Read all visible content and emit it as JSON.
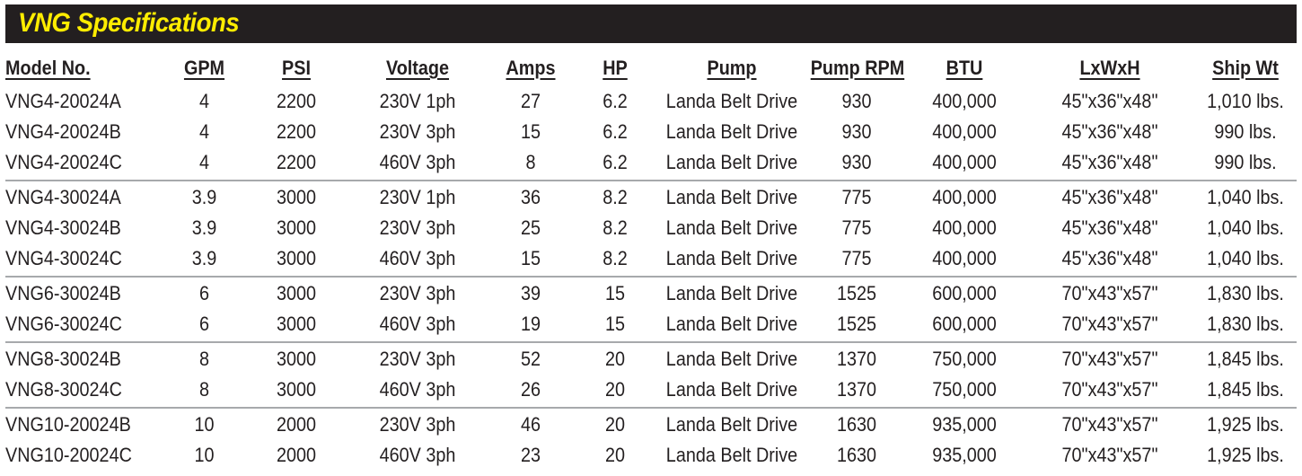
{
  "title": "VNG Specifications",
  "colors": {
    "title_bar": "#231f20",
    "title_text": "#ffed00",
    "separator": "#a7a9ac"
  },
  "columns": [
    "Model No.",
    "GPM",
    "PSI",
    "Voltage",
    "Amps",
    "HP",
    "Pump",
    "Pump RPM",
    "BTU",
    "LxWxH",
    "Ship Wt"
  ],
  "groups": [
    [
      [
        "VNG4-20024A",
        "4",
        "2200",
        "230V 1ph",
        "27",
        "6.2",
        "Landa Belt Drive",
        "930",
        "400,000",
        "45\"x36\"x48\"",
        "1,010 lbs."
      ],
      [
        "VNG4-20024B",
        "4",
        "2200",
        "230V 3ph",
        "15",
        "6.2",
        "Landa Belt Drive",
        "930",
        "400,000",
        "45\"x36\"x48\"",
        "990 lbs."
      ],
      [
        "VNG4-20024C",
        "4",
        "2200",
        "460V 3ph",
        "8",
        "6.2",
        "Landa Belt Drive",
        "930",
        "400,000",
        "45\"x36\"x48\"",
        "990 lbs."
      ]
    ],
    [
      [
        "VNG4-30024A",
        "3.9",
        "3000",
        "230V 1ph",
        "36",
        "8.2",
        "Landa Belt Drive",
        "775",
        "400,000",
        "45\"x36\"x48\"",
        "1,040 lbs."
      ],
      [
        "VNG4-30024B",
        "3.9",
        "3000",
        "230V 3ph",
        "25",
        "8.2",
        "Landa Belt Drive",
        "775",
        "400,000",
        "45\"x36\"x48\"",
        "1,040 lbs."
      ],
      [
        "VNG4-30024C",
        "3.9",
        "3000",
        "460V 3ph",
        "15",
        "8.2",
        "Landa Belt Drive",
        "775",
        "400,000",
        "45\"x36\"x48\"",
        "1,040 lbs."
      ]
    ],
    [
      [
        "VNG6-30024B",
        "6",
        "3000",
        "230V 3ph",
        "39",
        "15",
        "Landa Belt Drive",
        "1525",
        "600,000",
        "70\"x43\"x57\"",
        "1,830 lbs."
      ],
      [
        "VNG6-30024C",
        "6",
        "3000",
        "460V 3ph",
        "19",
        "15",
        "Landa Belt Drive",
        "1525",
        "600,000",
        "70\"x43\"x57\"",
        "1,830 lbs."
      ]
    ],
    [
      [
        "VNG8-30024B",
        "8",
        "3000",
        "230V 3ph",
        "52",
        "20",
        "Landa Belt Drive",
        "1370",
        "750,000",
        "70\"x43\"x57\"",
        "1,845 lbs."
      ],
      [
        "VNG8-30024C",
        "8",
        "3000",
        "460V 3ph",
        "26",
        "20",
        "Landa Belt Drive",
        "1370",
        "750,000",
        "70\"x43\"x57\"",
        "1,845 lbs."
      ]
    ],
    [
      [
        "VNG10-20024B",
        "10",
        "2000",
        "230V 3ph",
        "46",
        "20",
        "Landa Belt Drive",
        "1630",
        "935,000",
        "70\"x43\"x57\"",
        "1,925 lbs."
      ],
      [
        "VNG10-20024C",
        "10",
        "2000",
        "460V 3ph",
        "23",
        "20",
        "Landa Belt Drive",
        "1630",
        "935,000",
        "70\"x43\"x57\"",
        "1,925 lbs."
      ]
    ]
  ]
}
